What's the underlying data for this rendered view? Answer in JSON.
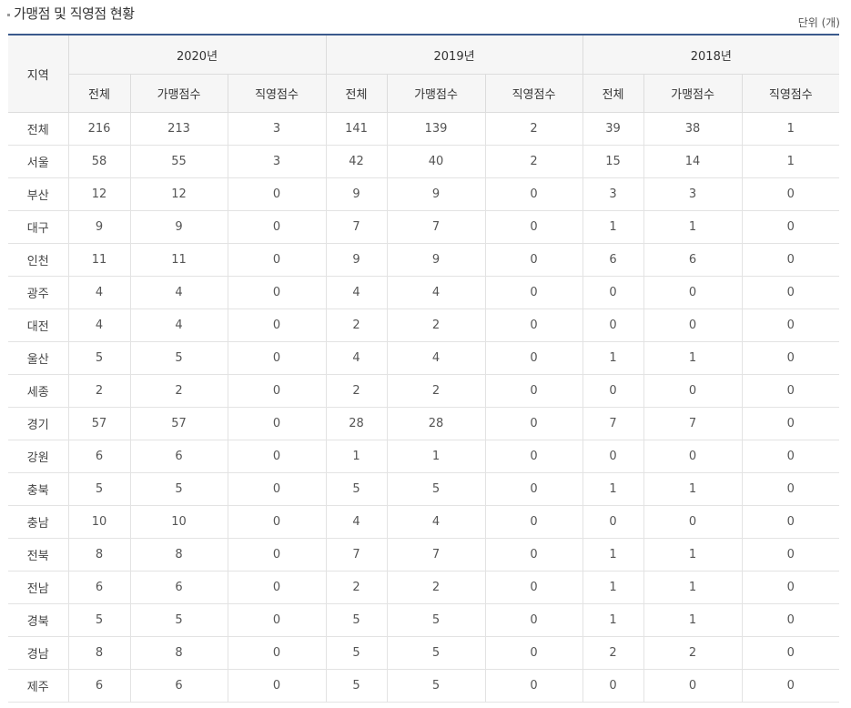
{
  "title": "가맹점 및 직영점 현황",
  "unit": "단위 (개)",
  "colors": {
    "header_border": "#3a5a8c",
    "header_bg": "#f6f6f6"
  },
  "table": {
    "region_header": "지역",
    "years": [
      "2020년",
      "2019년",
      "2018년"
    ],
    "sub_headers": [
      "전체",
      "가맹점수",
      "직영점수"
    ],
    "rows": [
      {
        "region": "전체",
        "values": [
          "216",
          "213",
          "3",
          "141",
          "139",
          "2",
          "39",
          "38",
          "1"
        ]
      },
      {
        "region": "서울",
        "values": [
          "58",
          "55",
          "3",
          "42",
          "40",
          "2",
          "15",
          "14",
          "1"
        ]
      },
      {
        "region": "부산",
        "values": [
          "12",
          "12",
          "0",
          "9",
          "9",
          "0",
          "3",
          "3",
          "0"
        ]
      },
      {
        "region": "대구",
        "values": [
          "9",
          "9",
          "0",
          "7",
          "7",
          "0",
          "1",
          "1",
          "0"
        ]
      },
      {
        "region": "인천",
        "values": [
          "11",
          "11",
          "0",
          "9",
          "9",
          "0",
          "6",
          "6",
          "0"
        ]
      },
      {
        "region": "광주",
        "values": [
          "4",
          "4",
          "0",
          "4",
          "4",
          "0",
          "0",
          "0",
          "0"
        ]
      },
      {
        "region": "대전",
        "values": [
          "4",
          "4",
          "0",
          "2",
          "2",
          "0",
          "0",
          "0",
          "0"
        ]
      },
      {
        "region": "울산",
        "values": [
          "5",
          "5",
          "0",
          "4",
          "4",
          "0",
          "1",
          "1",
          "0"
        ]
      },
      {
        "region": "세종",
        "values": [
          "2",
          "2",
          "0",
          "2",
          "2",
          "0",
          "0",
          "0",
          "0"
        ]
      },
      {
        "region": "경기",
        "values": [
          "57",
          "57",
          "0",
          "28",
          "28",
          "0",
          "7",
          "7",
          "0"
        ]
      },
      {
        "region": "강원",
        "values": [
          "6",
          "6",
          "0",
          "1",
          "1",
          "0",
          "0",
          "0",
          "0"
        ]
      },
      {
        "region": "충북",
        "values": [
          "5",
          "5",
          "0",
          "5",
          "5",
          "0",
          "1",
          "1",
          "0"
        ]
      },
      {
        "region": "충남",
        "values": [
          "10",
          "10",
          "0",
          "4",
          "4",
          "0",
          "0",
          "0",
          "0"
        ]
      },
      {
        "region": "전북",
        "values": [
          "8",
          "8",
          "0",
          "7",
          "7",
          "0",
          "1",
          "1",
          "0"
        ]
      },
      {
        "region": "전남",
        "values": [
          "6",
          "6",
          "0",
          "2",
          "2",
          "0",
          "1",
          "1",
          "0"
        ]
      },
      {
        "region": "경북",
        "values": [
          "5",
          "5",
          "0",
          "5",
          "5",
          "0",
          "1",
          "1",
          "0"
        ]
      },
      {
        "region": "경남",
        "values": [
          "8",
          "8",
          "0",
          "5",
          "5",
          "0",
          "2",
          "2",
          "0"
        ]
      },
      {
        "region": "제주",
        "values": [
          "6",
          "6",
          "0",
          "5",
          "5",
          "0",
          "0",
          "0",
          "0"
        ]
      }
    ]
  }
}
